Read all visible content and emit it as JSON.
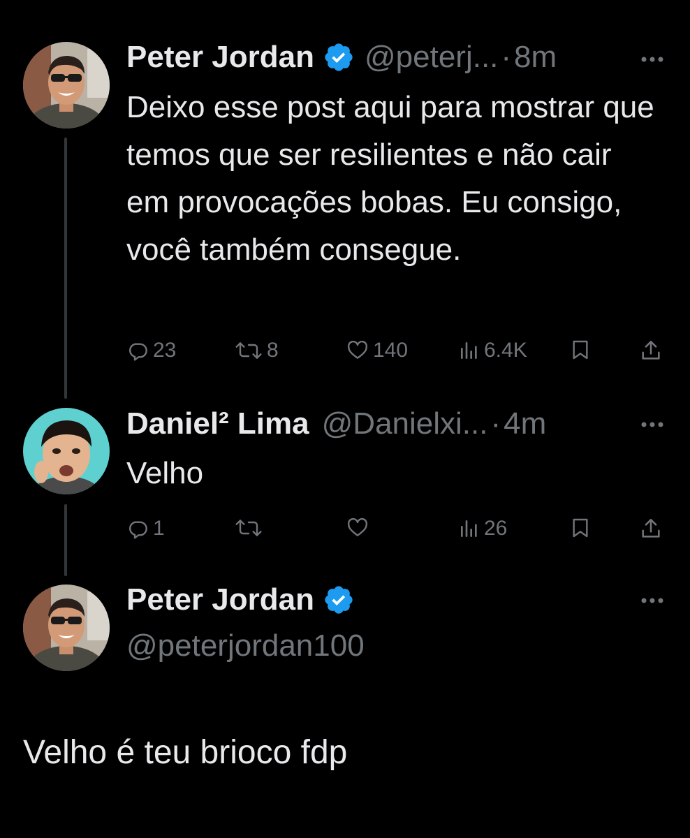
{
  "tweet1": {
    "author": "Peter Jordan",
    "handle": "@peterj...",
    "separator": "·",
    "time": "8m",
    "text": "Deixo esse post aqui para mostrar que temos que ser resilientes e não cair em provocações bobas. Eu consigo, você também consegue.",
    "replies": "23",
    "reposts": "8",
    "likes": "140",
    "views": "6.4K",
    "verified": true
  },
  "tweet2": {
    "author": "Daniel² Lima",
    "handle": "@Danielxi...",
    "separator": "·",
    "time": "4m",
    "text": "Velho",
    "replies": "1",
    "views": "26",
    "verified": false
  },
  "tweet3": {
    "author": "Peter Jordan",
    "handle": "@peterjordan100",
    "verified": true
  },
  "reply_text": "Velho é teu brioco fdp",
  "colors": {
    "background": "#000000",
    "primary_text": "#e7e9ea",
    "secondary_text": "#71767b",
    "verified_blue": "#1d9bf0",
    "thread_line": "#333639"
  },
  "icons": {
    "reply": "reply-icon",
    "repost": "repost-icon",
    "like": "heart-icon",
    "views": "views-icon",
    "bookmark": "bookmark-icon",
    "share": "share-icon",
    "more": "more-icon",
    "verified": "verified-badge-icon"
  }
}
